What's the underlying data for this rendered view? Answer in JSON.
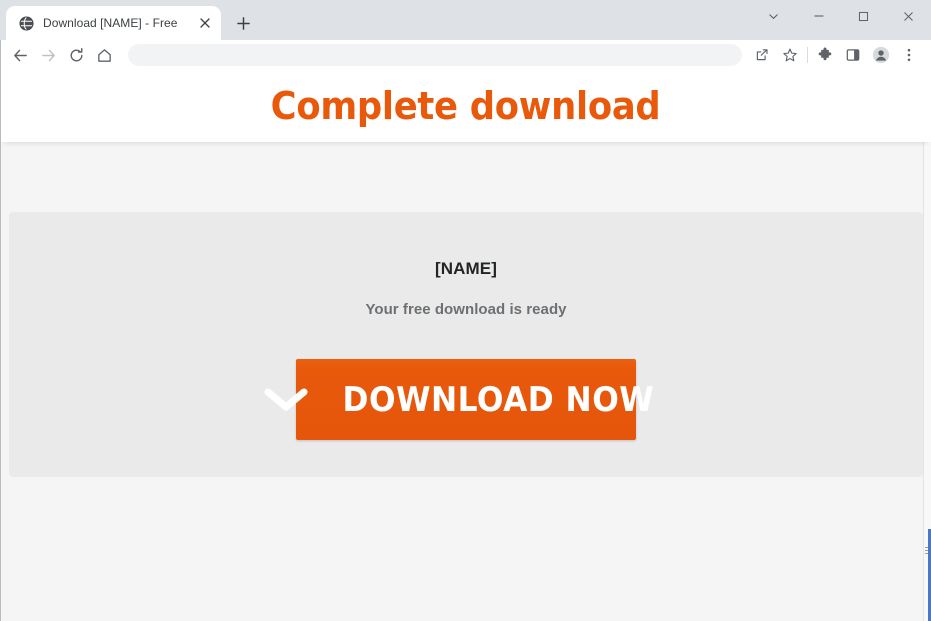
{
  "browser": {
    "tab": {
      "title": "Download [NAME] - Free",
      "favicon": "globe-icon",
      "close_label": "×"
    },
    "new_tab_label": "+",
    "window_controls": {
      "tab_search": "tab-search-chevron-icon",
      "minimize": "minimize-icon",
      "maximize": "maximize-icon",
      "close": "close-icon"
    },
    "toolbar": {
      "back": "back-arrow-icon",
      "forward": "forward-arrow-icon",
      "reload": "reload-icon",
      "home": "home-icon",
      "address_value": "",
      "address_placeholder": "",
      "share": "share-icon",
      "bookmark": "bookmark-star-icon",
      "extensions": "puzzle-piece-icon",
      "side_panel": "side-panel-icon",
      "profile": "profile-avatar-icon",
      "menu": "three-dot-menu-icon"
    }
  },
  "page": {
    "header_title": "Complete download",
    "card": {
      "file_name": "[NAME]",
      "status_text": "Your free download is ready",
      "button_label": "DOWNLOAD NOW",
      "button_icon": "chevron-down-icon"
    }
  },
  "colors": {
    "accent_orange": "#e8590c",
    "page_background": "#f5f5f5",
    "card_background": "#eaeaea",
    "header_background": "#ffffff",
    "tabstrip_background": "#dee1e6"
  }
}
